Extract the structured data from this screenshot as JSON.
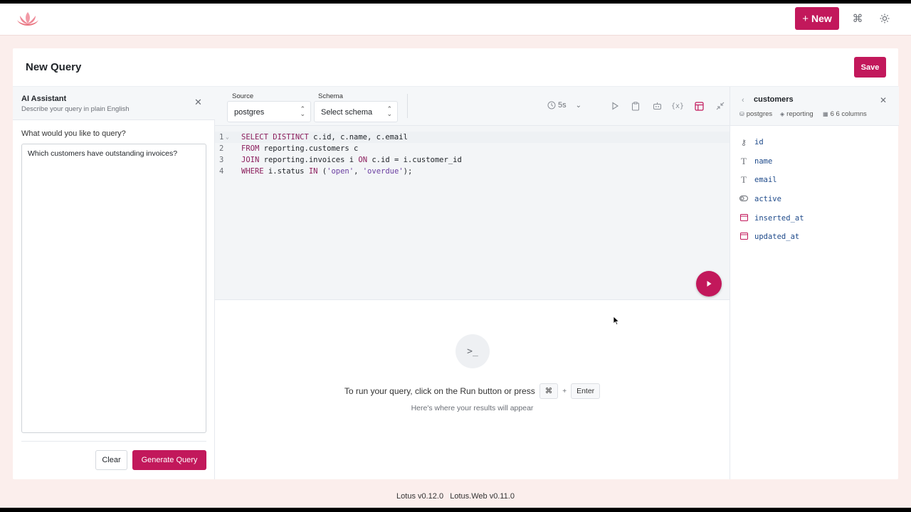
{
  "header": {
    "new_label": "New",
    "new_icon": "plus-icon",
    "brand_color": "#c2185b"
  },
  "page": {
    "title": "New Query",
    "save_label": "Save"
  },
  "ai_panel": {
    "title": "AI Assistant",
    "subtitle": "Describe your query in plain English",
    "prompt_label": "What would you like to query?",
    "prompt_value": "Which customers have outstanding invoices?",
    "clear_label": "Clear",
    "generate_label": "Generate Query"
  },
  "toolbar": {
    "source_label": "Source",
    "source_value": "postgres",
    "schema_label": "Schema",
    "schema_value": "Select schema",
    "timeout_value": "5s"
  },
  "editor": {
    "lines": [
      {
        "num": "1",
        "text": "SELECT DISTINCT c.id, c.name, c.email"
      },
      {
        "num": "2",
        "text": "FROM reporting.customers c"
      },
      {
        "num": "3",
        "text": "JOIN reporting.invoices i ON c.id = i.customer_id"
      },
      {
        "num": "4",
        "text": "WHERE i.status IN ('open', 'overdue');"
      }
    ]
  },
  "results": {
    "hint": "To run your query, click on the Run button or press",
    "key_modifier": "⌘",
    "key_plus": "+",
    "key_enter": "Enter",
    "sub": "Here's where your results will appear"
  },
  "schema_panel": {
    "table_name": "customers",
    "source": "postgres",
    "schema": "reporting",
    "columns_count": "6 6 columns",
    "columns": [
      {
        "name": "id",
        "icon": "key-icon"
      },
      {
        "name": "name",
        "icon": "text-type-icon"
      },
      {
        "name": "email",
        "icon": "text-type-icon"
      },
      {
        "name": "active",
        "icon": "toggle-icon"
      },
      {
        "name": "inserted_at",
        "icon": "calendar-icon"
      },
      {
        "name": "updated_at",
        "icon": "calendar-icon"
      }
    ]
  },
  "footer": {
    "version_text": "Lotus v0.12.0   Lotus.Web v0.11.0"
  }
}
